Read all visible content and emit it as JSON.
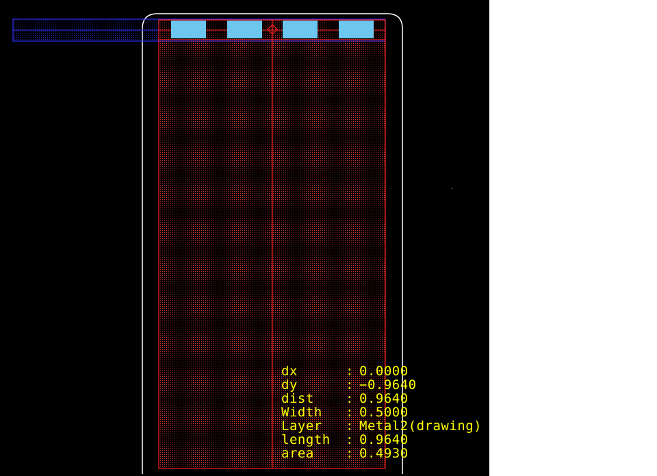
{
  "canvas": {
    "background": "#000000",
    "colors": {
      "metal2": "#ff2020",
      "metal1": "#3030ff",
      "via": "#6cc6ee",
      "boundary": "#ffffff",
      "text": "#ffff00"
    }
  },
  "measurement": {
    "separator": ":",
    "rows": [
      {
        "key": "dx",
        "value": "0.0000"
      },
      {
        "key": "dy",
        "value": "−0.9640"
      },
      {
        "key": "dist",
        "value": "0.9640"
      },
      {
        "key": "Width",
        "value": "0.5000"
      },
      {
        "key": "Layer",
        "value": "Metal2(drawing)"
      },
      {
        "key": "length",
        "value": "0.9640"
      },
      {
        "key": "area",
        "value": "0.4930"
      }
    ]
  }
}
